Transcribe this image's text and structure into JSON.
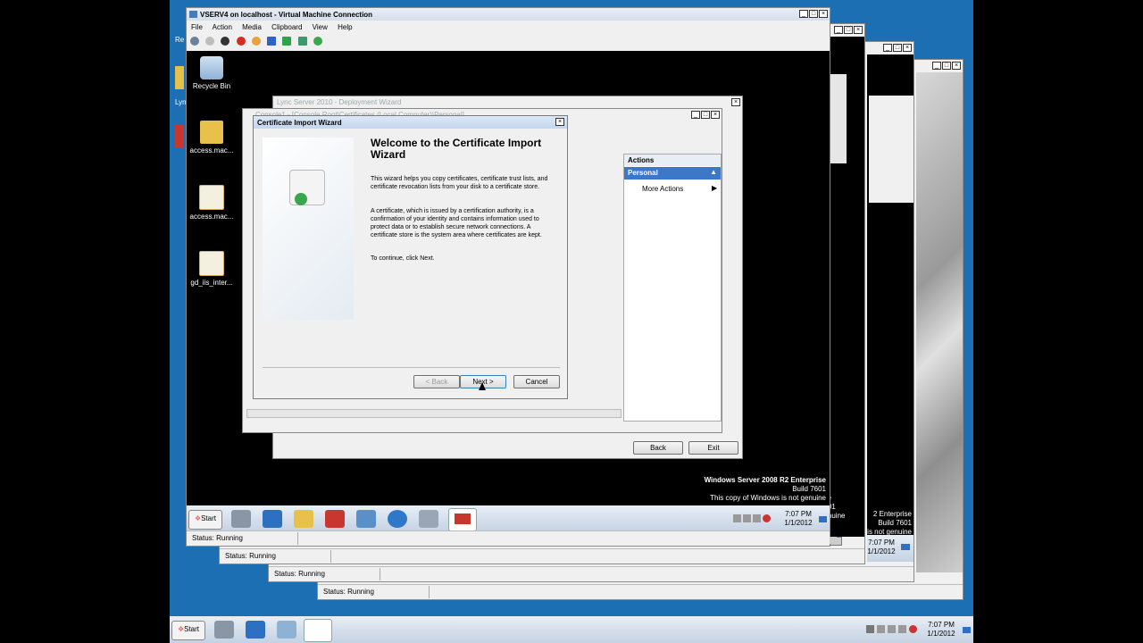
{
  "vm_main": {
    "title": "VSERV4 on localhost - Virtual Machine Connection",
    "menu": [
      "File",
      "Action",
      "Media",
      "Clipboard",
      "View",
      "Help"
    ],
    "status": "Status: Running"
  },
  "vm_stack_status": [
    "Status: Running",
    "Status: Running",
    "Status: Running"
  ],
  "desktop_icons": [
    "Recycle Bin",
    "access.mac...",
    "access.mac...",
    "gd_iis_inter..."
  ],
  "deployment_wizard": {
    "title": "Lync Server 2010 - Deployment Wizard",
    "back": "Back",
    "exit": "Exit"
  },
  "console": {
    "title": "Console1 - [Console Root\\Certificates (Local Computer)\\Personal]",
    "actions_header": "Actions",
    "actions_group": "Personal",
    "more_actions": "More Actions"
  },
  "wizard": {
    "title": "Certificate Import Wizard",
    "heading": "Welcome to the Certificate Import Wizard",
    "p1": "This wizard helps you copy certificates, certificate trust lists, and certificate revocation lists from your disk to a certificate store.",
    "p2": "A certificate, which is issued by a certification authority, is a confirmation of your identity and contains information used to protect data or to establish secure network connections. A certificate store is the system area where certificates are kept.",
    "p3": "To continue, click Next.",
    "back": "< Back",
    "next": "Next >",
    "cancel": "Cancel"
  },
  "vm_watermark": {
    "line1": "Windows Server 2008 R2 Enterprise",
    "line2": "Build 7601",
    "line3": "This copy of Windows is not genuine"
  },
  "stack_watermark": {
    "a1": "rise",
    "a2": "7601",
    "a3": "genuine",
    "b1": "2 Enterprise",
    "b2": "Build 7601",
    "b3": "is not genuine"
  },
  "vm_taskbar": {
    "start": "Start",
    "time": "7:07 PM",
    "date": "1/1/2012"
  },
  "stack_clock": {
    "time": "7:07 PM",
    "date": "1/1/2012"
  },
  "host_taskbar": {
    "start": "Start",
    "time": "7:07 PM",
    "date": "1/1/2012"
  },
  "misc": {
    "re_label": "Re",
    "lyn_label": "Lyn"
  },
  "colors": {
    "host_desktop": "#1d6fb4",
    "title_active": "#3a6fc9",
    "actions_blue": "#3d77c8"
  }
}
